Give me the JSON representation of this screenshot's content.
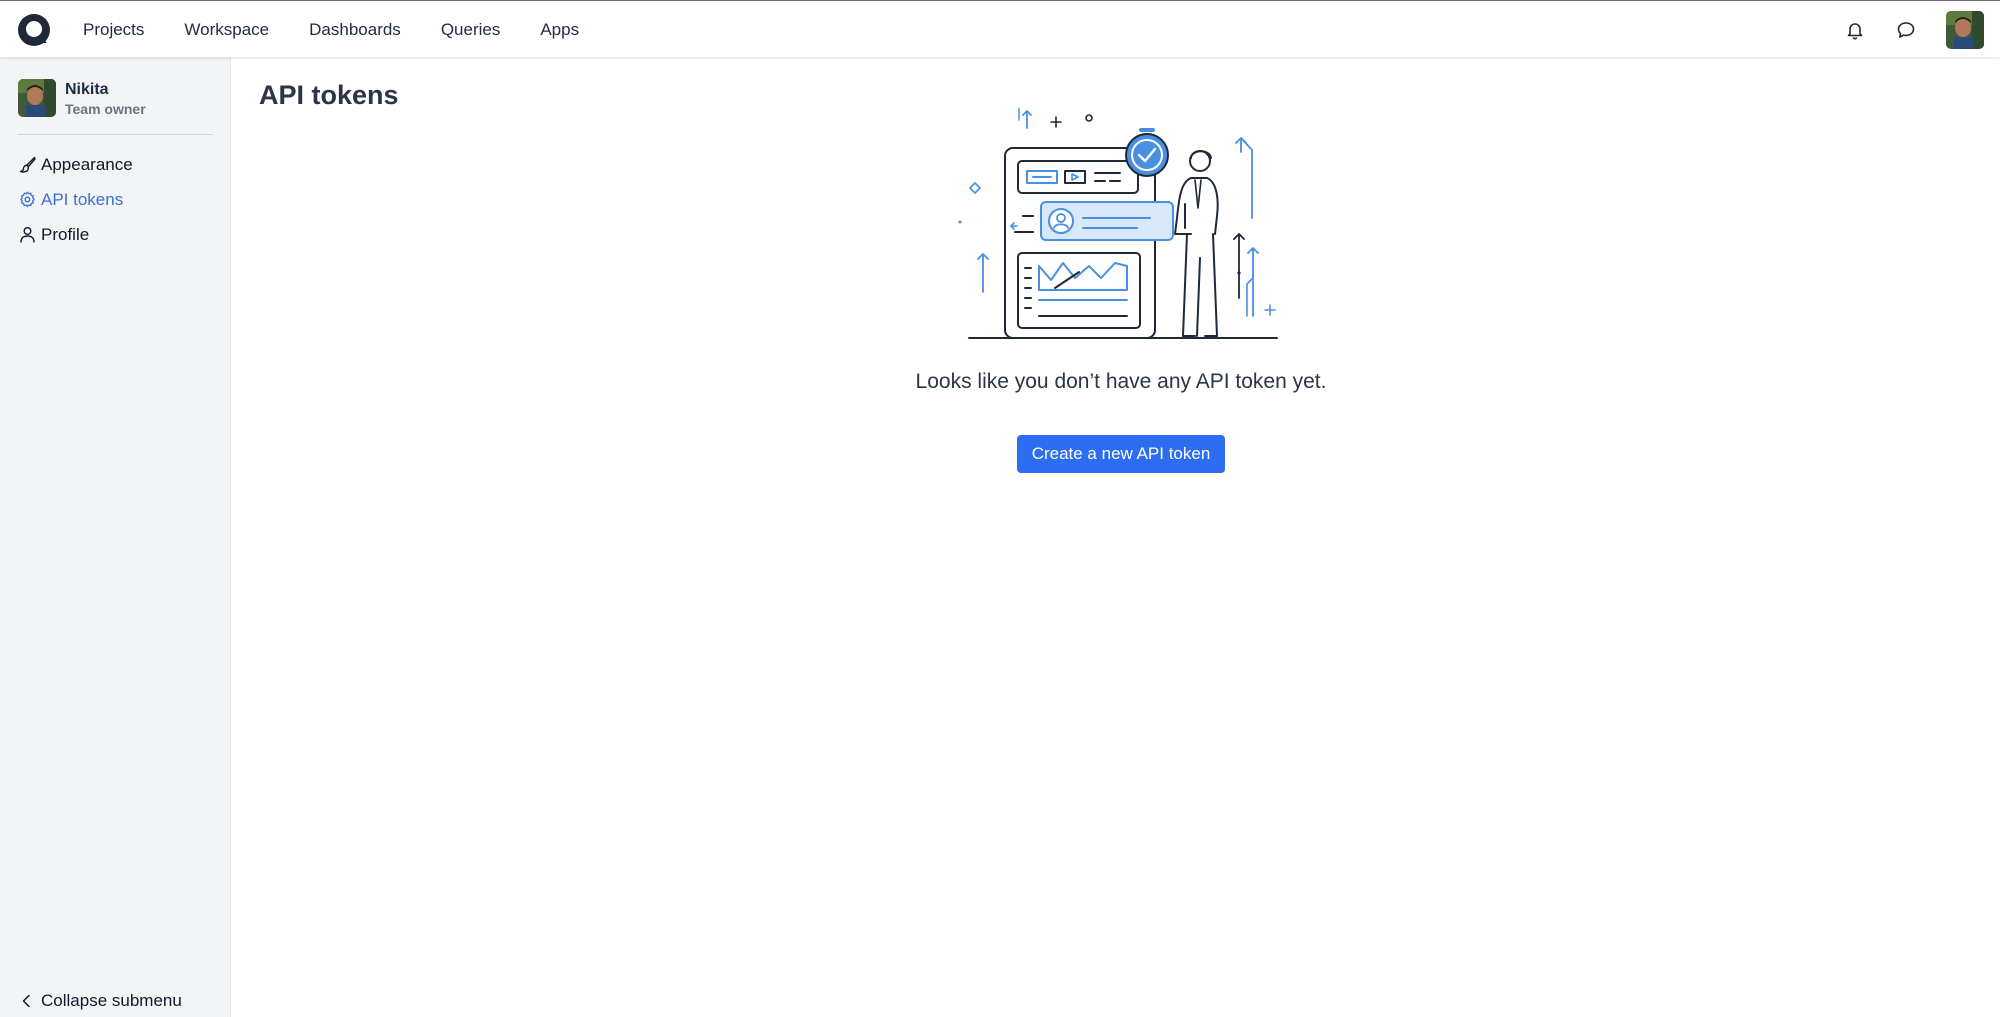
{
  "nav": {
    "items": [
      {
        "label": "Projects"
      },
      {
        "label": "Workspace"
      },
      {
        "label": "Dashboards"
      },
      {
        "label": "Queries"
      },
      {
        "label": "Apps"
      }
    ],
    "icons": [
      "bell-icon",
      "chat-icon"
    ]
  },
  "sidebar": {
    "user": {
      "name": "Nikita",
      "role": "Team owner"
    },
    "items": [
      {
        "label": "Appearance",
        "icon": "brush-icon",
        "active": false
      },
      {
        "label": "API tokens",
        "icon": "gear-icon",
        "active": true
      },
      {
        "label": "Profile",
        "icon": "person-icon",
        "active": false
      }
    ],
    "collapse_label": "Collapse submenu"
  },
  "main": {
    "title": "API tokens",
    "empty_message": "Looks like you don’t have any API token yet.",
    "create_label": "Create a new API token"
  },
  "colors": {
    "primary": "#2d6df2",
    "active_link": "#3d6fd8",
    "sidebar_bg": "#f3f4f6",
    "illustration_accent": "#4a90e2"
  }
}
